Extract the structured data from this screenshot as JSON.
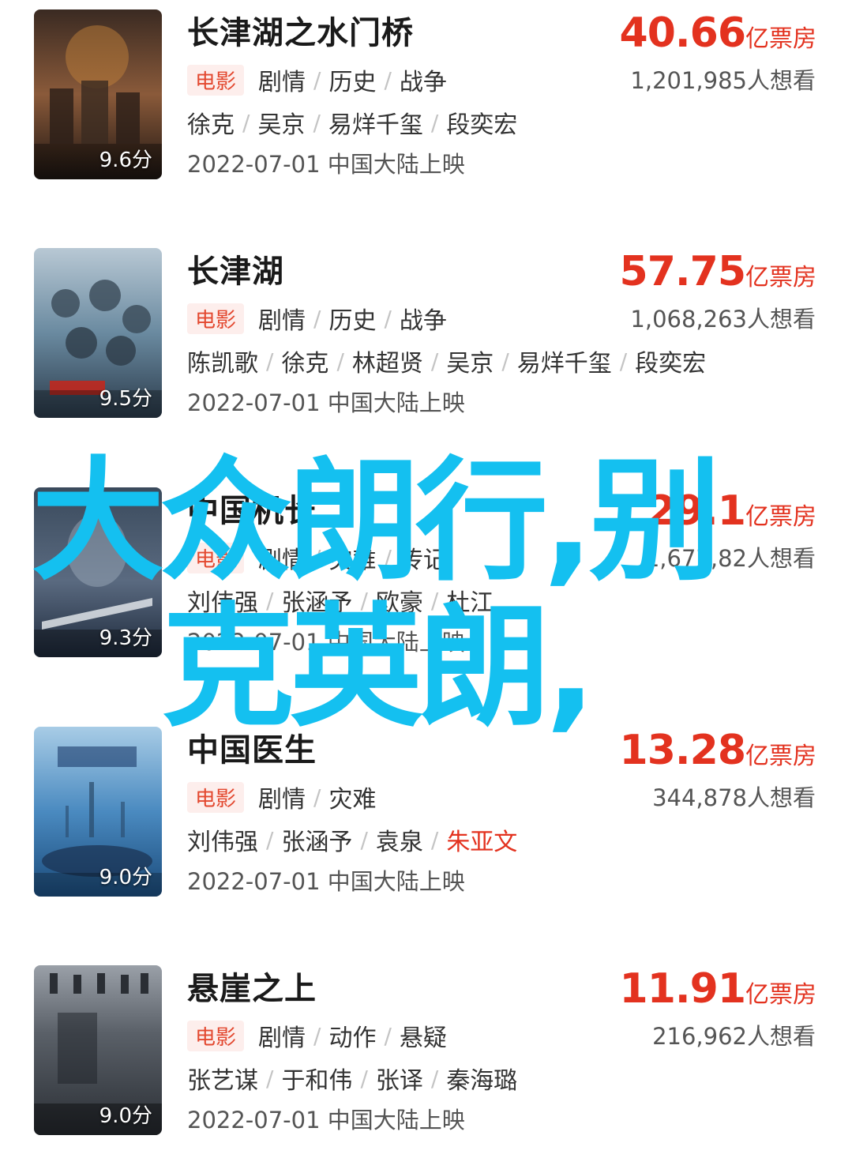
{
  "movies": [
    {
      "title": "长津湖之水门桥",
      "rating": "9.6分",
      "box_office_num": "40.66",
      "box_office_unit": "亿票房",
      "type_tag": "电影",
      "genres": [
        "剧情",
        "历史",
        "战争"
      ],
      "want": "1,201,985人想看",
      "cast": [
        "徐克",
        "吴京",
        "易烊千玺",
        "段奕宏"
      ],
      "release": "2022-07-01 中国大陆上映",
      "poster_colors": [
        "#3a2a22",
        "#8a5a3a",
        "#c0803a"
      ]
    },
    {
      "title": "长津湖",
      "rating": "9.5分",
      "box_office_num": "57.75",
      "box_office_unit": "亿票房",
      "type_tag": "电影",
      "genres": [
        "剧情",
        "历史",
        "战争"
      ],
      "want": "1,068,263人想看",
      "cast": [
        "陈凯歌",
        "徐克",
        "林超贤",
        "吴京",
        "易烊千玺",
        "段奕宏"
      ],
      "release": "2022-07-01 中国大陆上映",
      "poster_colors": [
        "#2a3a4a",
        "#6a8aa0",
        "#b8c8d4"
      ]
    },
    {
      "title": "中国机长",
      "rating": "9.3分",
      "box_office_num": "29.1",
      "box_office_unit": "亿票房",
      "type_tag": "电影",
      "genres": [
        "剧情",
        "灾难",
        "传记"
      ],
      "want": "1,677,82人想看",
      "cast": [
        "刘伟强",
        "张涵予",
        "欧豪",
        "杜江"
      ],
      "release": "2022-07-01 中国大陆上映",
      "poster_colors": [
        "#1e2a3c",
        "#5a6a80",
        "#9aa8b8"
      ]
    },
    {
      "title": "中国医生",
      "rating": "9.0分",
      "box_office_num": "13.28",
      "box_office_unit": "亿票房",
      "type_tag": "电影",
      "genres": [
        "剧情",
        "灾难"
      ],
      "want": "344,878人想看",
      "cast": [
        "刘伟强",
        "张涵予",
        "袁泉",
        "朱亚文"
      ],
      "cast_highlight_index": 3,
      "release": "2022-07-01 中国大陆上映",
      "poster_colors": [
        "#1a4a7a",
        "#4a8ac0",
        "#a8cce6"
      ]
    },
    {
      "title": "悬崖之上",
      "rating": "9.0分",
      "box_office_num": "11.91",
      "box_office_unit": "亿票房",
      "type_tag": "电影",
      "genres": [
        "剧情",
        "动作",
        "悬疑"
      ],
      "want": "216,962人想看",
      "cast": [
        "张艺谋",
        "于和伟",
        "张译",
        "秦海璐"
      ],
      "release": "2022-07-01 中国大陆上映",
      "poster_colors": [
        "#2a2e34",
        "#5a6068",
        "#9aa0a8"
      ]
    }
  ],
  "overlay": {
    "line1": "大众朗行,别",
    "line2": "克英朗,"
  },
  "colors": {
    "accent_red": "#e3321f",
    "overlay_cyan": "#14c0f0"
  }
}
